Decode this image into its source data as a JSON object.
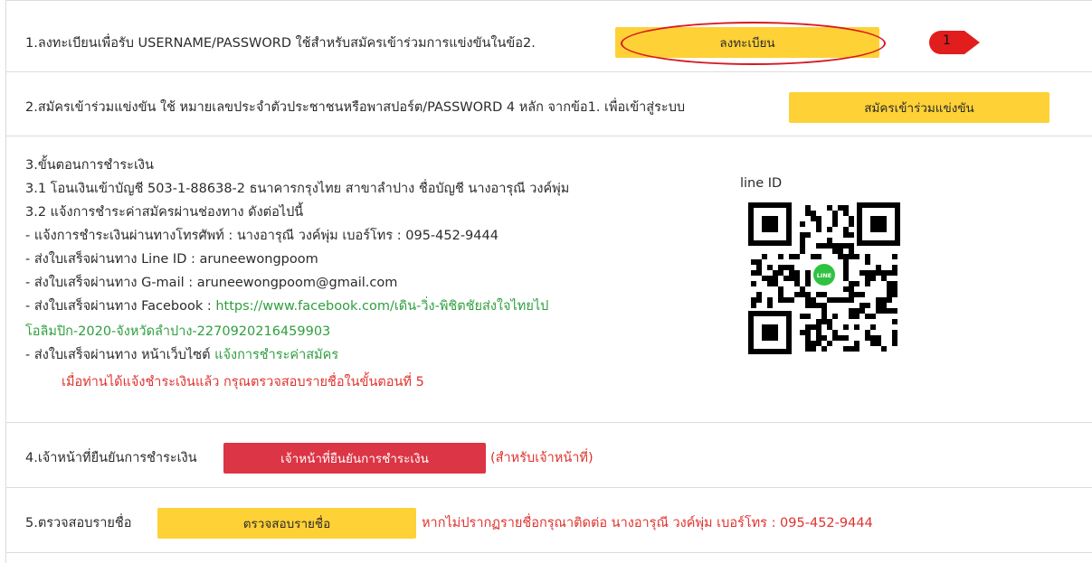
{
  "step1": {
    "text": "1.ลงทะเบียนเพื่อรับ USERNAME/PASSWORD ใช้สำหรับสมัครเข้าร่วมการแข่งขันในข้อ2.",
    "button": "ลงทะเบียน",
    "marker": "1"
  },
  "step2": {
    "text": "2.สมัครเข้าร่วมแข่งขัน ใช้ หมายเลขประจำตัวประชาชนหรือพาสปอร์ต/PASSWORD 4 หลัก จากข้อ1. เพื่อเข้าสู่ระบบ",
    "button": "สมัครเข้าร่วมแข่งขัน"
  },
  "step3": {
    "title": "3.ขั้นตอนการชำระเงิน",
    "bank": "3.1 โอนเงินเข้าบัญชี 503-1-88638-2 ธนาคารกรุงไทย สาขาลำปาง ชื่อบัญชี นางอารุณี วงค์พุ่ม",
    "notify": "3.2 แจ้งการชำระค่าสมัครผ่านช่องทาง ดังต่อไปนี้",
    "phone": "- แจ้งการชำระเงินผ่านทางโทรศัพท์ : นางอารุณี วงค์พุ่ม เบอร์โทร : 095-452-9444",
    "line_id": "- ส่งใบเสร็จผ่านทาง Line ID : aruneewongpoom",
    "gmail": "- ส่งใบเสร็จผ่านทาง G-mail : aruneewongpoom@gmail.com",
    "facebook_label": "- ส่งใบเสร็จผ่านทาง Facebook : ",
    "facebook_link_1": "https://www.facebook.com/เดิน-วิ่ง-พิชิตชัยส่งใจไทยไป",
    "facebook_link_2": "โอลิมปิก-2020-จังหวัดลำปาง-2270920216459903",
    "website_label": "- ส่งใบเสร็จผ่านทาง หน้าเว็บไซต์ ",
    "website_link": "แจ้งการชำระค่าสมัคร",
    "note": "เมื่อท่านได้แจ้งชำระเงินแล้ว กรุณตรวจสอบรายชื่อในขั้นตอนที่ 5",
    "qr_label": "line ID",
    "qr_center": "LINE"
  },
  "step4": {
    "text": "4.เจ้าหน้าที่ยืนยันการชำระเงิน",
    "button": "เจ้าหน้าที่ยืนยันการชำระเงิน",
    "note": "(สำหรับเจ้าหน้าที่)"
  },
  "step5": {
    "text": "5.ตรวจสอบรายชื่อ",
    "button": "ตรวจสอบรายชื่อ",
    "note": "หากไม่ปรากฏรายชื่อกรุณาติดต่อ นางอารุณี วงค์พุ่ม เบอร์โทร : 095-452-9444"
  },
  "colors": {
    "yellow_button": "#fed136",
    "red_button": "#dc3545",
    "link_green": "#2e9e3e",
    "note_red": "#e0322d",
    "annotation_red": "#d71920"
  }
}
